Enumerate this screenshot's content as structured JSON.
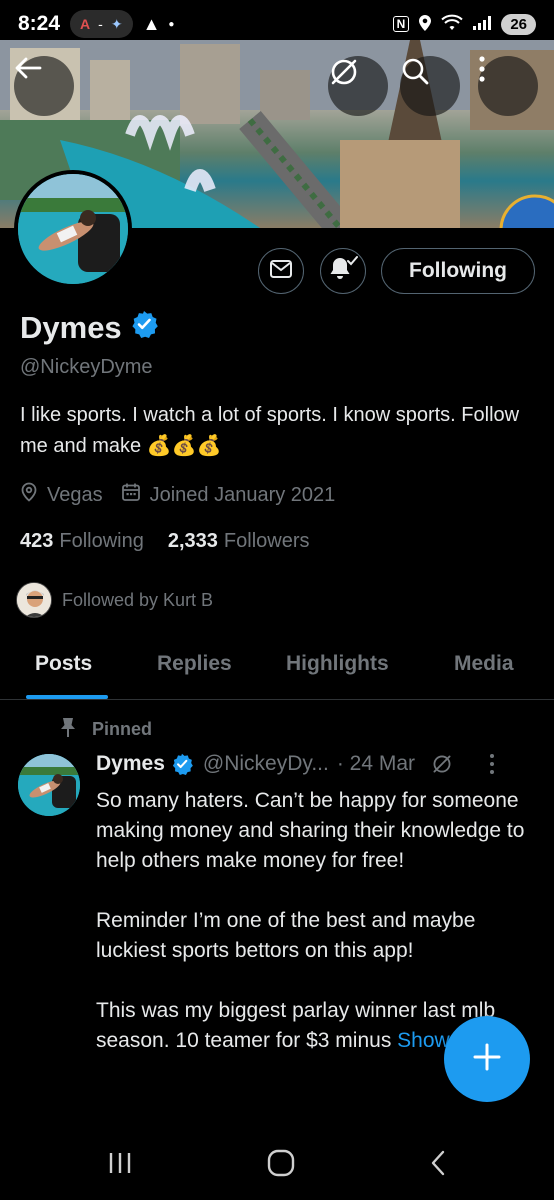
{
  "status_bar": {
    "time": "8:24",
    "pill_text": "-",
    "battery": "26",
    "network": "5"
  },
  "header": {
    "back_icon": "arrow-left-icon",
    "grok_icon": "slash-circle-icon",
    "search_icon": "search-icon",
    "more_icon": "more-vertical-icon"
  },
  "profile": {
    "name": "Dymes",
    "handle": "@NickeyDyme",
    "bio": "I like sports. I watch a lot of sports. I know sports. Follow me and make 💰💰💰",
    "location": "Vegas",
    "joined": "Joined January 2021",
    "following_count": "423",
    "following_label": "Following",
    "followers_count": "2,333",
    "followers_label": "Followers",
    "followed_by": "Followed by Kurt B",
    "following_button": "Following"
  },
  "tabs": [
    {
      "label": "Posts",
      "active": true
    },
    {
      "label": "Replies",
      "active": false
    },
    {
      "label": "Highlights",
      "active": false
    },
    {
      "label": "Media",
      "active": false
    }
  ],
  "pinned_post": {
    "pinned_label": "Pinned",
    "name": "Dymes",
    "handle": "@NickeyDy...",
    "time": "· 24 Mar",
    "body": "So many haters. Can’t be happy for someone making money and sharing their knowledge to help others make money for free!\n\nReminder I’m one of the best and maybe luckiest sports bettors on this app!\n\nThis was my biggest parlay winner last mlb season. 10 teamer for $3 minus",
    "show_more": "Show more"
  },
  "colors": {
    "accent": "#1d9bf0",
    "muted": "#71767b",
    "text": "#e7e9ea",
    "border": "#536471"
  }
}
